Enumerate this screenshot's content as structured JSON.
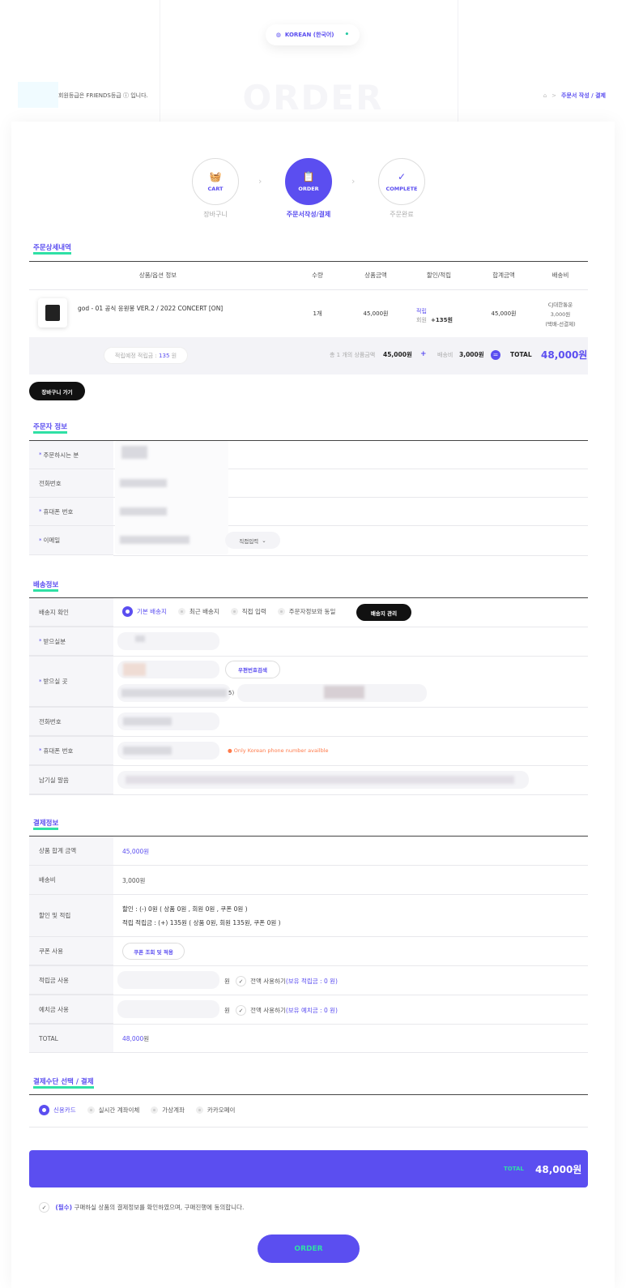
{
  "language": {
    "label": "KOREAN (한국어)",
    "icon": "globe-icon"
  },
  "member": {
    "text": "회원등급은 FRIENDS등급 ⓘ 입니다."
  },
  "page_heading": "ORDER",
  "breadcrumb": {
    "home_icon": "home-icon",
    "sep": ">",
    "current": "주문서 작성 / 결제"
  },
  "steps": [
    {
      "label": "CART",
      "sub": "장바구니",
      "icon": "basket-icon"
    },
    {
      "label": "ORDER",
      "sub": "주문서작성/결제",
      "icon": "clipboard-icon"
    },
    {
      "label": "COMPLETE",
      "sub": "주문완료",
      "icon": "check-circle-icon"
    }
  ],
  "order_detail": {
    "title": "주문상세내역",
    "headers": [
      "상품/옵션 정보",
      "수량",
      "상품금액",
      "할인/적립",
      "합계금액",
      "배송비"
    ],
    "item": {
      "name": "god - 01 공식 응원봉 VER.2 / 2022 CONCERT [ON]",
      "qty": "1개",
      "price": "45,000원",
      "point_label": "적립",
      "point_member": "회원",
      "point_value": "+135원",
      "total": "45,000원",
      "ship1": "CJ대한통운",
      "ship2": "3,000원",
      "ship3": "(택배-선결제)"
    },
    "summary": {
      "expected_point_label": "적립예정 적립금 :",
      "expected_point_value": "135",
      "expected_point_unit": "원",
      "count_text": "총 1 개의 상품금액",
      "goods_amount": "45,000원",
      "plus": "+",
      "ship_label": "배송비",
      "ship_amount": "3,000원",
      "equals": "=",
      "total_label": "TOTAL",
      "total_amount": "48,000원"
    },
    "cart_button": "장바구니 가기"
  },
  "orderer": {
    "title": "주문자 정보",
    "fields": [
      {
        "label": "주문하시는 분",
        "required": true
      },
      {
        "label": "전화번호",
        "required": false
      },
      {
        "label": "휴대폰 번호",
        "required": true
      },
      {
        "label": "이메일",
        "required": true
      }
    ],
    "email_select": "직접입력"
  },
  "shipping": {
    "title": "배송정보",
    "confirm_label": "배송지 확인",
    "options": [
      "기본 배송지",
      "최근 배송지",
      "직접 입력",
      "주문자정보와 동일"
    ],
    "manage_button": "배송지 관리",
    "fields": [
      {
        "label": "받으실분",
        "required": true
      },
      {
        "label": "받으실 곳",
        "required": true
      },
      {
        "label": "전화번호",
        "required": false
      },
      {
        "label": "휴대폰 번호",
        "required": true
      },
      {
        "label": "남기실 말씀",
        "required": false
      }
    ],
    "zip_button": "우편번호검색",
    "address_tail": "5)",
    "phone_warning": "Only Korean phone number availble"
  },
  "payment_info": {
    "title": "결제정보",
    "rows": [
      {
        "label": "상품 합계 금액",
        "value": "45,000원"
      },
      {
        "label": "배송비",
        "value": "3,000원"
      },
      {
        "label": "할인 및 적립",
        "value": ""
      },
      {
        "label": "쿠폰 사용",
        "value": ""
      },
      {
        "label": "적립금 사용",
        "value": ""
      },
      {
        "label": "예치금 사용",
        "value": ""
      },
      {
        "label": "TOTAL",
        "value": ""
      }
    ],
    "discount_line": "할인 : (-) 0원 ( 상품 0원 , 회원 0원 , 쿠폰 0원 )",
    "point_line": "적립 적립금 : (+) 135원 ( 상품 0원, 회원 135원, 쿠폰 0원 )",
    "coupon_button": "쿠폰 조회 및 적용",
    "won": "원",
    "use_all": "전액 사용하기",
    "point_owned": "(보유 적립금 : 0 원)",
    "deposit_owned": "(보유 예치금 : 0 원)",
    "total_value": "48,000",
    "total_unit": "원"
  },
  "method": {
    "title": "결제수단 선택 / 결제",
    "options": [
      "신용카드",
      "실시간 계좌이체",
      "가상계좌",
      "카카오페이"
    ]
  },
  "final": {
    "total_label": "TOTAL",
    "total_value": "48,000원"
  },
  "agree": {
    "required": "(필수)",
    "text": "구매하실 상품의 결제정보를 확인하였으며, 구매진행에 동의합니다."
  },
  "order_button": "ORDER"
}
